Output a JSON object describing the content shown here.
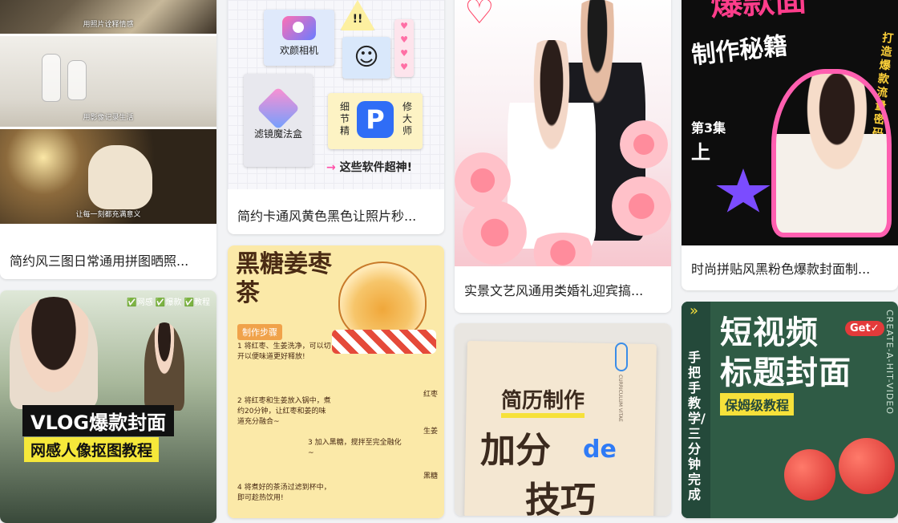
{
  "cards": [
    {
      "caption": "简约风三图日常通用拼图晒照...",
      "subs": [
        "用照片诠释情感",
        "用影像记录生活",
        "让每一刻都充满意义"
      ]
    },
    {
      "caption": "",
      "tags": "✅网感 ✅爆款 ✅教程",
      "big": "VLOG爆款封面",
      "small": "网感人像抠图教程"
    },
    {
      "caption": "简约卡通风黄色黑色让照片秒...",
      "camera": "欢颜相机",
      "warn": "!!",
      "filter": "滤镜魔法盒",
      "p_left": "细节精",
      "p_right": "修大师",
      "foot_arrow": "→",
      "foot": "这些软件超神!"
    },
    {
      "caption": "",
      "title": "黑糖姜枣茶",
      "steps_header": "制作步骤",
      "steps": [
        "1 将红枣、生姜洗净，可以切开以便味道更好释放!",
        "2 将红枣和生姜放入锅中，煮约20分钟，让红枣和姜的味道充分融合~",
        "3 加入黑糖，搅拌至完全融化~",
        "4 将煮好的茶汤过滤到杯中，即可趁热饮用!"
      ],
      "side_items": [
        "红枣",
        "生姜",
        "黑糖"
      ]
    },
    {
      "caption": "实景文艺风通用类婚礼迎宾搞..."
    },
    {
      "caption": "",
      "h1": "简历制作",
      "h2": "加分",
      "de": "de",
      "h3": "技巧",
      "side": "CURRICULUM VITAE"
    },
    {
      "caption": "时尚拼贴风黑粉色爆款封面制...",
      "t1": "爆款面",
      "t2": "制作秘籍",
      "t3": "打造爆款流量密码",
      "ep": "第3集",
      "up": "上"
    },
    {
      "caption": "",
      "h1": "短视频",
      "h2": "标题封面",
      "tag": "保姆级教程",
      "get": "Get✓",
      "vt": "手把手教学/三分钟完成",
      "side": "CREATE-A-HIT-VIDEO"
    }
  ]
}
